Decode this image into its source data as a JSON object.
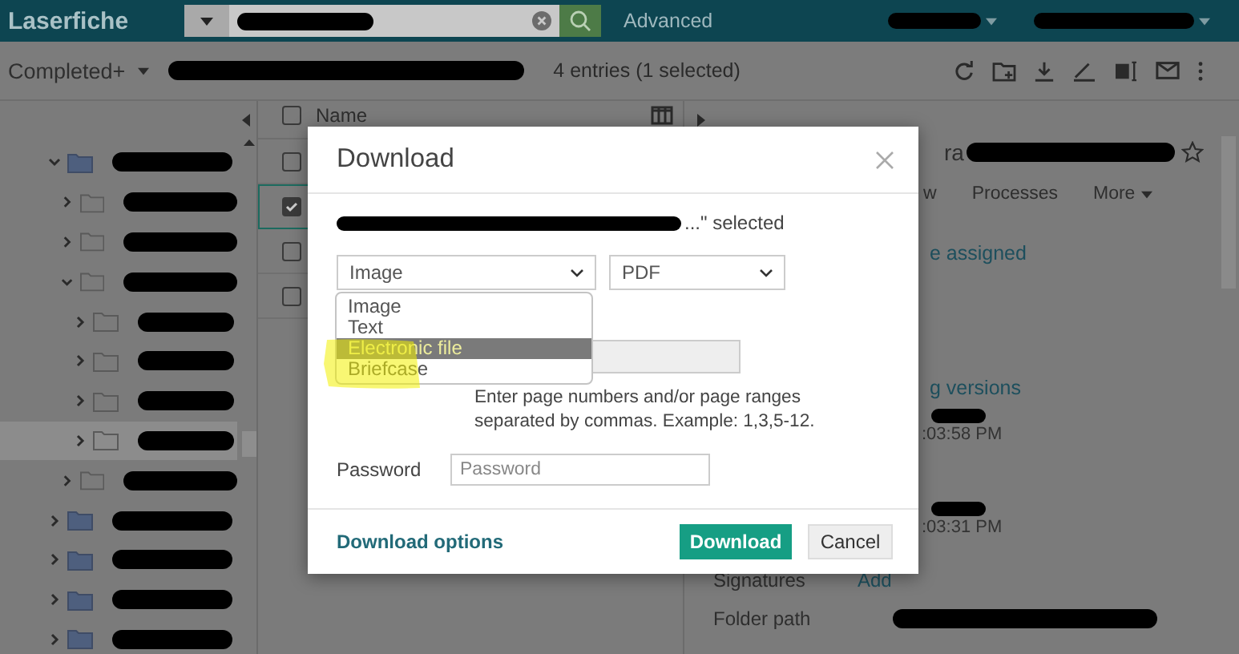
{
  "top_bar": {
    "logo": "Laserfiche",
    "advanced_link": "Advanced"
  },
  "path_bar": {
    "folder": "Completed+",
    "entry_count": "4 entries (1 selected)"
  },
  "tree": [
    {
      "kind": "repository",
      "expanded": true,
      "selected": false,
      "children": [
        {
          "kind": "folder",
          "expanded": false,
          "selected": false
        },
        {
          "kind": "folder",
          "expanded": false,
          "selected": false
        },
        {
          "kind": "folder",
          "expanded": true,
          "selected": false,
          "children": [
            {
              "kind": "folder",
              "expanded": false,
              "selected": false
            },
            {
              "kind": "folder",
              "expanded": false,
              "selected": false
            },
            {
              "kind": "folder",
              "expanded": false,
              "selected": false
            },
            {
              "kind": "folder",
              "expanded": false,
              "selected": true
            }
          ]
        },
        {
          "kind": "folder",
          "expanded": false,
          "selected": false
        }
      ]
    },
    {
      "kind": "repository",
      "expanded": false,
      "selected": false
    },
    {
      "kind": "repository",
      "expanded": false,
      "selected": false
    },
    {
      "kind": "repository",
      "expanded": false,
      "selected": false
    },
    {
      "kind": "repository",
      "expanded": false,
      "selected": false
    }
  ],
  "list": {
    "column": "Name",
    "all_checked": false,
    "rows": [
      {
        "checked": false
      },
      {
        "checked": true
      },
      {
        "checked": false
      },
      {
        "checked": false
      }
    ]
  },
  "details": {
    "title_fragment": "ra",
    "tabs": [
      "w",
      "Processes",
      "More"
    ],
    "assigned_fragment": "e assigned",
    "versions_fragment": "g versions",
    "times": [
      ":03:58 PM",
      ":03:31 PM"
    ],
    "signatures_label": "Signatures",
    "signatures_action": "Add",
    "folder_path_label": "Folder path"
  },
  "dialog": {
    "title": "Download",
    "selected_text": "...\" selected",
    "content_select": "Image",
    "format_select": "PDF",
    "content_options": [
      {
        "label": "Image",
        "selected": false
      },
      {
        "label": "Text",
        "selected": false
      },
      {
        "label": "Electronic file",
        "selected": true
      },
      {
        "label": "Briefcase",
        "selected": false
      }
    ],
    "page_range_hint": "Enter page numbers and/or page ranges separated by commas. Example: 1,3,5-12.",
    "password_label": "Password",
    "password_placeholder": "Password",
    "options_link": "Download options",
    "download_button": "Download",
    "cancel_button": "Cancel"
  }
}
